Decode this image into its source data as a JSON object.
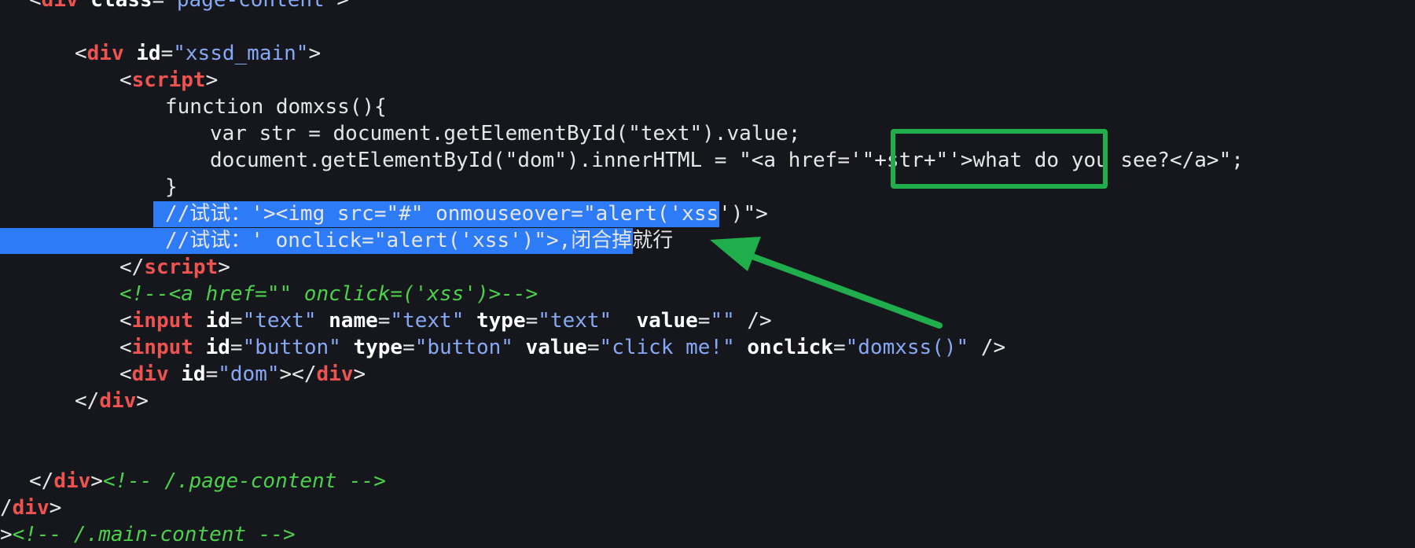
{
  "code_lines": [
    {
      "tokens": [
        {
          "t": "<",
          "c": "plain"
        },
        {
          "t": "div",
          "c": "tag"
        },
        {
          "t": " class",
          "c": "attr"
        },
        {
          "t": "=",
          "c": "plain"
        },
        {
          "t": "\"page-content\"",
          "c": "str"
        },
        {
          "t": ">",
          "c": "plain"
        }
      ]
    },
    {
      "tokens": []
    },
    {
      "tokens": [
        {
          "t": "<",
          "c": "plain"
        },
        {
          "t": "div",
          "c": "tag"
        },
        {
          "t": " id",
          "c": "attr"
        },
        {
          "t": "=",
          "c": "plain"
        },
        {
          "t": "\"xssd_main\"",
          "c": "str"
        },
        {
          "t": ">",
          "c": "plain"
        }
      ]
    },
    {
      "tokens": [
        {
          "t": "<",
          "c": "plain"
        },
        {
          "t": "script",
          "c": "tag"
        },
        {
          "t": ">",
          "c": "plain"
        }
      ]
    },
    {
      "tokens": [
        {
          "t": "function domxss(){",
          "c": "plain"
        }
      ]
    },
    {
      "tokens": [
        {
          "t": "var str = document.getElementById(\"text\").value;",
          "c": "plain"
        }
      ]
    },
    {
      "tokens": [
        {
          "t": "document.getElementById(\"dom\").innerHTML = \"<a href='\"+str+\"'>what do you see?</a>\";",
          "c": "plain"
        }
      ]
    },
    {
      "tokens": [
        {
          "t": "}",
          "c": "plain"
        }
      ]
    },
    {
      "tokens": [
        {
          "t": "//试试：'><img src=\"#\" onmouseover=\"alert('xss')\">",
          "c": "plain"
        }
      ]
    },
    {
      "tokens": [
        {
          "t": "//试试：' onclick=\"alert('xss')\">,闭合掉就行",
          "c": "plain"
        }
      ]
    },
    {
      "tokens": [
        {
          "t": "</",
          "c": "plain"
        },
        {
          "t": "script",
          "c": "tag"
        },
        {
          "t": ">",
          "c": "plain"
        }
      ]
    },
    {
      "tokens": [
        {
          "t": "<!--<a href=\"\" onclick=('xss')>-->",
          "c": "cmt"
        }
      ]
    },
    {
      "tokens": [
        {
          "t": "<",
          "c": "plain"
        },
        {
          "t": "input",
          "c": "tag"
        },
        {
          "t": " id",
          "c": "attr"
        },
        {
          "t": "=",
          "c": "plain"
        },
        {
          "t": "\"text\"",
          "c": "str"
        },
        {
          "t": " name",
          "c": "attr"
        },
        {
          "t": "=",
          "c": "plain"
        },
        {
          "t": "\"text\"",
          "c": "str"
        },
        {
          "t": " type",
          "c": "attr"
        },
        {
          "t": "=",
          "c": "plain"
        },
        {
          "t": "\"text\"",
          "c": "str"
        },
        {
          "t": "  value",
          "c": "attr"
        },
        {
          "t": "=",
          "c": "plain"
        },
        {
          "t": "\"\"",
          "c": "str"
        },
        {
          "t": " />",
          "c": "plain"
        }
      ]
    },
    {
      "tokens": [
        {
          "t": "<",
          "c": "plain"
        },
        {
          "t": "input",
          "c": "tag"
        },
        {
          "t": " id",
          "c": "attr"
        },
        {
          "t": "=",
          "c": "plain"
        },
        {
          "t": "\"button\"",
          "c": "str"
        },
        {
          "t": " type",
          "c": "attr"
        },
        {
          "t": "=",
          "c": "plain"
        },
        {
          "t": "\"button\"",
          "c": "str"
        },
        {
          "t": " value",
          "c": "attr"
        },
        {
          "t": "=",
          "c": "plain"
        },
        {
          "t": "\"click me!\"",
          "c": "str"
        },
        {
          "t": " onclick",
          "c": "attr"
        },
        {
          "t": "=",
          "c": "plain"
        },
        {
          "t": "\"domxss()\"",
          "c": "str"
        },
        {
          "t": " />",
          "c": "plain"
        }
      ]
    },
    {
      "tokens": [
        {
          "t": "<",
          "c": "plain"
        },
        {
          "t": "div",
          "c": "tag"
        },
        {
          "t": " id",
          "c": "attr"
        },
        {
          "t": "=",
          "c": "plain"
        },
        {
          "t": "\"dom\"",
          "c": "str"
        },
        {
          "t": "></",
          "c": "plain"
        },
        {
          "t": "div",
          "c": "tag"
        },
        {
          "t": ">",
          "c": "plain"
        }
      ]
    },
    {
      "tokens": [
        {
          "t": "</",
          "c": "plain"
        },
        {
          "t": "div",
          "c": "tag"
        },
        {
          "t": ">",
          "c": "plain"
        }
      ]
    },
    {
      "tokens": []
    },
    {
      "tokens": []
    },
    {
      "tokens": [
        {
          "t": "</",
          "c": "plain"
        },
        {
          "t": "div",
          "c": "tag"
        },
        {
          "t": ">",
          "c": "plain"
        },
        {
          "t": "<!-- /.page-content -->",
          "c": "cmt"
        }
      ]
    },
    {
      "tokens": [
        {
          "t": "/",
          "c": "plain"
        },
        {
          "t": "div",
          "c": "tag"
        },
        {
          "t": ">",
          "c": "plain"
        }
      ]
    },
    {
      "tokens": [
        {
          "t": ">",
          "c": "plain"
        },
        {
          "t": "<!-- /.main-content -->",
          "c": "cmt"
        }
      ]
    }
  ],
  "colors": {
    "background": "#16171d",
    "selection": "#2d7bf7",
    "annotation": "#1fae4b"
  },
  "annotations": {
    "box": "green-highlight-box",
    "arrow": "green-arrow"
  }
}
